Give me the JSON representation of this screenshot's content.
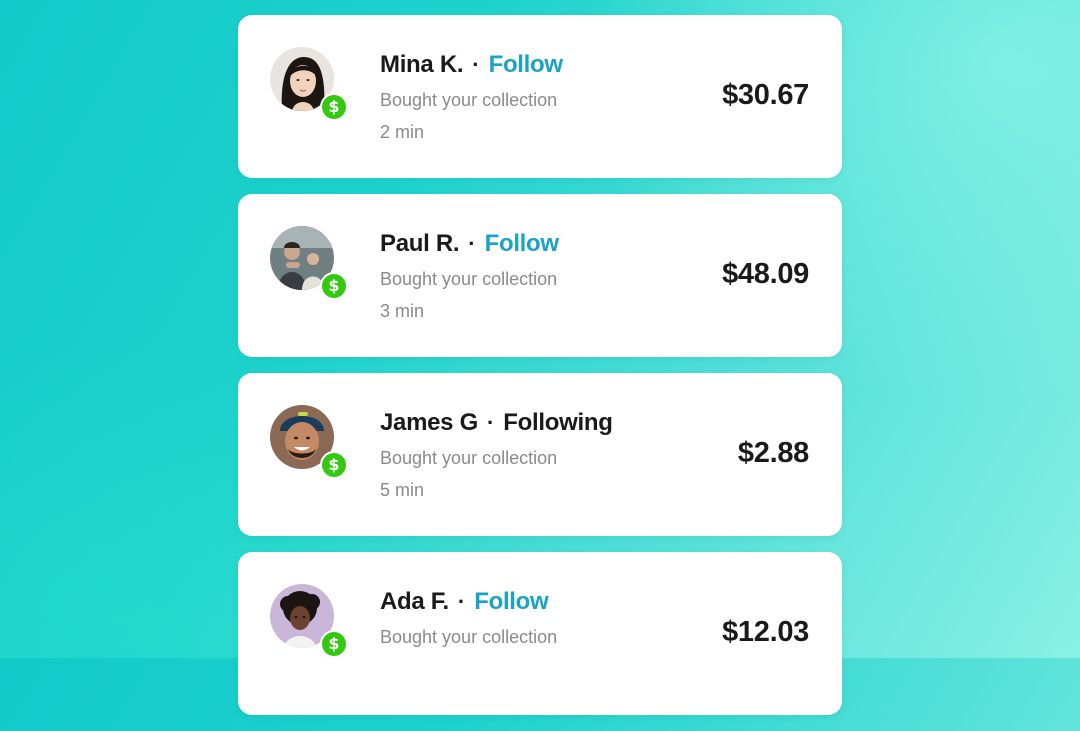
{
  "currency_icon": "dollar-sign-icon",
  "badge_color": "#35c811",
  "follow_color": "#1aa3c4",
  "separator": "·",
  "badge_symbol": "$",
  "activities": [
    {
      "name": "Mina K.",
      "follow_label": "Follow",
      "following": false,
      "description": "Bought your collection",
      "time": "2 min",
      "amount": "$30.67"
    },
    {
      "name": "Paul R.",
      "follow_label": "Follow",
      "following": false,
      "description": "Bought your collection",
      "time": "3 min",
      "amount": "$48.09"
    },
    {
      "name": "James G",
      "follow_label": "Following",
      "following": true,
      "description": "Bought your collection",
      "time": "5 min",
      "amount": "$2.88"
    },
    {
      "name": "Ada F.",
      "follow_label": "Follow",
      "following": false,
      "description": "Bought your collection",
      "time": "",
      "amount": "$12.03"
    }
  ]
}
